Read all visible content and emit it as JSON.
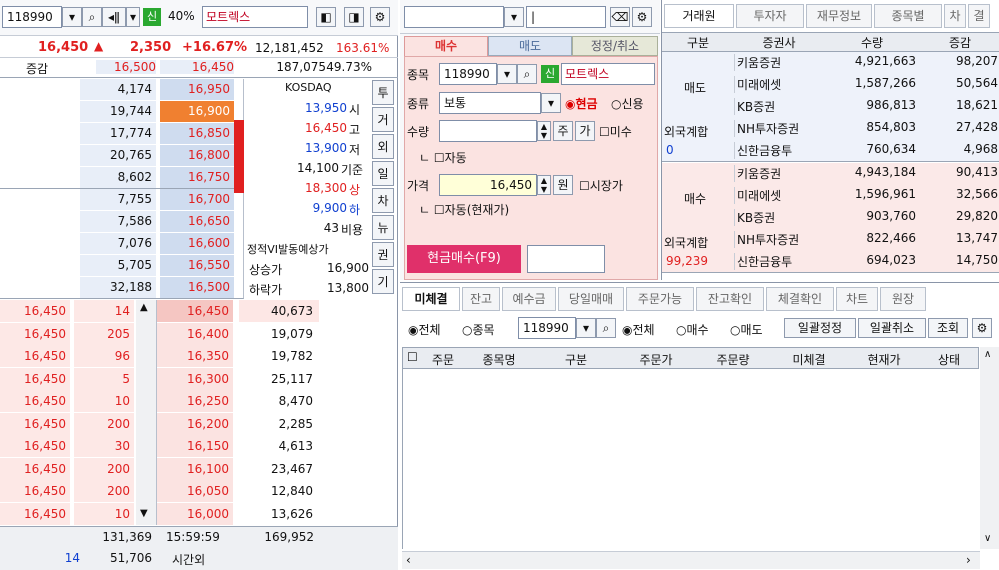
{
  "left": {
    "code": "118990",
    "badge": "신",
    "margin": "40%",
    "name": "모트렉스",
    "price": "16,450",
    "change": "2,350",
    "rate": "+16.67%",
    "volume": "12,181,452",
    "vol_ratio": "163.61%",
    "diff_label": "증감",
    "top_ask": "16,500",
    "top_price": "16,450",
    "top_vol": "187,075",
    "top_pct": "49.73%",
    "asks": [
      {
        "qty": "4,174",
        "price": "16,950"
      },
      {
        "qty": "19,744",
        "price": "16,900"
      },
      {
        "qty": "17,774",
        "price": "16,850"
      },
      {
        "qty": "20,765",
        "price": "16,800"
      },
      {
        "qty": "8,602",
        "price": "16,750"
      },
      {
        "qty": "7,755",
        "price": "16,700"
      },
      {
        "qty": "7,586",
        "price": "16,650"
      },
      {
        "qty": "7,076",
        "price": "16,600"
      },
      {
        "qty": "5,705",
        "price": "16,550"
      },
      {
        "qty": "32,188",
        "price": "16,500"
      }
    ],
    "info": {
      "market": "KOSDAQ",
      "open": "13,950",
      "open_l": "시",
      "high": "16,450",
      "high_l": "고",
      "low": "13,900",
      "low_l": "저",
      "base": "14,100",
      "base_l": "기준",
      "upper": "18,300",
      "upper_l": "상",
      "lower": "9,900",
      "lower_l": "하",
      "cost": "43",
      "cost_l": "비용",
      "vi": "정적VI발동예상가",
      "up_l": "상승가",
      "up_v": "16,900",
      "dn_l": "하락가",
      "dn_v": "13,800"
    },
    "side_btns": [
      "투",
      "거",
      "외",
      "일",
      "차",
      "뉴",
      "권",
      "기"
    ],
    "trades": [
      {
        "p": "16,450",
        "q": "14"
      },
      {
        "p": "16,450",
        "q": "205"
      },
      {
        "p": "16,450",
        "q": "96"
      },
      {
        "p": "16,450",
        "q": "5"
      },
      {
        "p": "16,450",
        "q": "10"
      },
      {
        "p": "16,450",
        "q": "200"
      },
      {
        "p": "16,450",
        "q": "30"
      },
      {
        "p": "16,450",
        "q": "200"
      },
      {
        "p": "16,450",
        "q": "200"
      },
      {
        "p": "16,450",
        "q": "10"
      }
    ],
    "bids": [
      {
        "price": "16,450",
        "qty": "40,673"
      },
      {
        "price": "16,400",
        "qty": "19,079"
      },
      {
        "price": "16,350",
        "qty": "19,782"
      },
      {
        "price": "16,300",
        "qty": "25,117"
      },
      {
        "price": "16,250",
        "qty": "8,470"
      },
      {
        "price": "16,200",
        "qty": "2,285"
      },
      {
        "price": "16,150",
        "qty": "4,613"
      },
      {
        "price": "16,100",
        "qty": "23,467"
      },
      {
        "price": "16,050",
        "qty": "12,840"
      },
      {
        "price": "16,000",
        "qty": "13,626"
      }
    ],
    "tot_ask": "131,369",
    "time": "15:59:59",
    "tot_bid": "169,952",
    "after_n": "14",
    "after_q": "51,706",
    "after_l": "시간외"
  },
  "order": {
    "tabs": [
      "매수",
      "매도",
      "정정/취소"
    ],
    "l_code": "종목",
    "code": "118990",
    "badge": "신",
    "name": "모트렉스",
    "l_type": "종류",
    "type": "보통",
    "cash": "현금",
    "credit": "신용",
    "l_qty": "수량",
    "btn_ju": "주",
    "btn_ga": "가",
    "misu": "미수",
    "auto": "자동",
    "l_price": "가격",
    "price": "16,450",
    "won": "원",
    "market": "시장가",
    "auto2": "자동(현재가)",
    "submit": "현금매수(F9)"
  },
  "broker": {
    "tabs": [
      "거래원",
      "투자자",
      "재무정보",
      "종목별",
      "차",
      "결"
    ],
    "cols": [
      "구분",
      "증권사",
      "수량",
      "증감"
    ],
    "sell_label": "매도",
    "sell": [
      {
        "n": "키움증권",
        "q": "4,921,663",
        "d": "98,207"
      },
      {
        "n": "미래에셋",
        "q": "1,587,266",
        "d": "50,564"
      },
      {
        "n": "KB증권",
        "q": "986,813",
        "d": "18,621"
      },
      {
        "n": "NH투자증권",
        "q": "854,803",
        "d": "27,428"
      },
      {
        "n": "신한금융투",
        "q": "760,634",
        "d": "4,968"
      }
    ],
    "foreign": "외국계합",
    "sell_foreign_v": "0",
    "buy_label": "매수",
    "buy": [
      {
        "n": "키움증권",
        "q": "4,943,184",
        "d": "90,413"
      },
      {
        "n": "미래에셋",
        "q": "1,596,961",
        "d": "32,566"
      },
      {
        "n": "KB증권",
        "q": "903,760",
        "d": "29,820"
      },
      {
        "n": "NH투자증권",
        "q": "822,466",
        "d": "13,747"
      },
      {
        "n": "신한금융투",
        "q": "694,023",
        "d": "14,750"
      }
    ],
    "buy_foreign_v": "99,239"
  },
  "bottom": {
    "tabs": [
      "미체결",
      "잔고",
      "예수금",
      "당일매매",
      "주문가능",
      "잔고확인",
      "체결확인",
      "차트",
      "원장"
    ],
    "all": "전체",
    "stock": "종목",
    "code": "118990",
    "all2": "전체",
    "buy": "매수",
    "sell": "매도",
    "modify": "일괄정정",
    "cancel": "일괄취소",
    "query": "조회",
    "cols": [
      "주문",
      "종목명",
      "구분",
      "주문가",
      "주문량",
      "미체결",
      "현재가",
      "상태"
    ]
  },
  "colors": {
    "red": "#e02020",
    "blue": "#1040d0",
    "ask_bg": "#e8eef8",
    "bid_bg": "#fbe3e1",
    "accent": "#f08030"
  }
}
